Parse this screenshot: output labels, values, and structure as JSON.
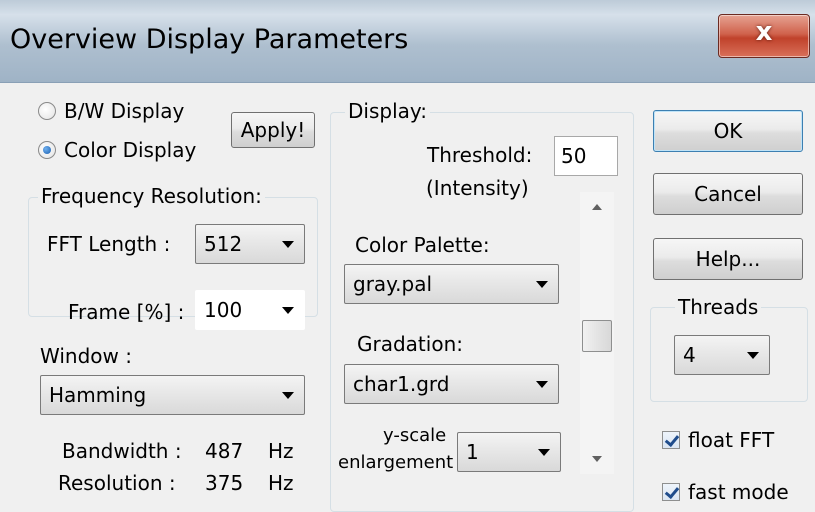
{
  "window": {
    "title": "Overview Display Parameters",
    "close_glyph": "x"
  },
  "display_mode": {
    "bw_label": "B/W Display",
    "color_label": "Color Display",
    "selected": "Color Display",
    "apply_label": "Apply!"
  },
  "frequency_resolution": {
    "legend": "Frequency Resolution:",
    "fft_length_label": "FFT Length :",
    "fft_length_value": "512",
    "frame_label": "Frame [%] :",
    "frame_value": "100",
    "window_label": "Window :",
    "window_value": "Hamming",
    "bandwidth_label": "Bandwidth :",
    "bandwidth_value": "487",
    "bandwidth_unit": "Hz",
    "resolution_label": "Resolution :",
    "resolution_value": "375",
    "resolution_unit": "Hz"
  },
  "display": {
    "legend": "Display:",
    "threshold_label": "Threshold:",
    "threshold_sublabel": "(Intensity)",
    "threshold_value": "50",
    "palette_label": "Color Palette:",
    "palette_value": "gray.pal",
    "gradation_label": "Gradation:",
    "gradation_value": "char1.grd",
    "yscale_label_line1": "y-scale",
    "yscale_label_line2": "enlargement :",
    "yscale_value": "1"
  },
  "buttons": {
    "ok": "OK",
    "cancel": "Cancel",
    "help": "Help..."
  },
  "threads": {
    "legend": "Threads",
    "value": "4"
  },
  "options": {
    "float_fft_label": "float FFT",
    "float_fft_checked": true,
    "fast_mode_label": "fast mode",
    "fast_mode_checked": true
  },
  "icons": {
    "close": "close-icon",
    "dropdown": "chevron-down-icon",
    "scroll_up": "scroll-up-arrow-icon",
    "scroll_down": "scroll-down-arrow-icon",
    "checkmark": "checkmark-icon"
  },
  "colors": {
    "title_bar": "#aebfcf",
    "close_button": "#c0422b",
    "dialog_background": "#f0f0f0",
    "radio_selected": "#1b5fb0"
  }
}
